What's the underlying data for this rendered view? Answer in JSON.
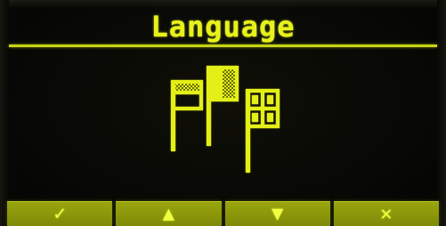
{
  "screen": {
    "title": "Language",
    "icon": "flags-icon",
    "accent_color": "#e8f21a",
    "softkeys": [
      {
        "name": "confirm",
        "icon": "checkmark-icon",
        "glyph": "✓"
      },
      {
        "name": "up",
        "icon": "arrow-up-icon",
        "glyph": "▲"
      },
      {
        "name": "down",
        "icon": "arrow-down-icon",
        "glyph": "▼"
      },
      {
        "name": "cancel",
        "icon": "cross-icon",
        "glyph": "✕"
      }
    ]
  }
}
